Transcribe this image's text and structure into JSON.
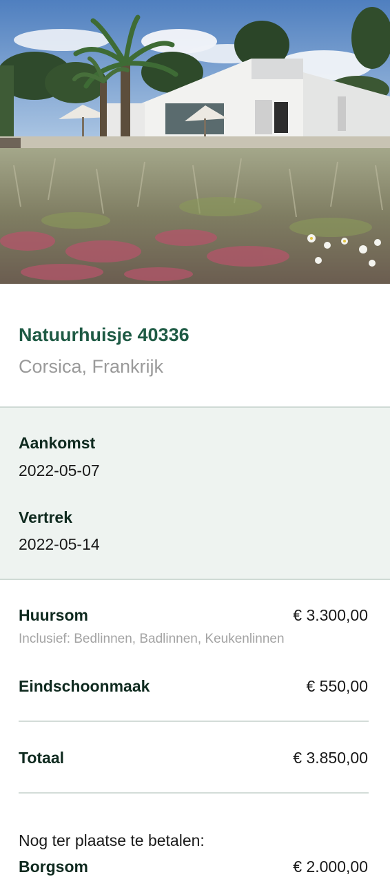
{
  "hero": {
    "photo_subject": "white-villa-with-palm-trees"
  },
  "house": {
    "name": "Natuurhuisje 40336",
    "location": "Corsica, Frankrijk"
  },
  "dates": {
    "arrival_label": "Aankomst",
    "arrival_value": "2022-05-07",
    "departure_label": "Vertrek",
    "departure_value": "2022-05-14"
  },
  "costs": {
    "rent_label": "Huursom",
    "rent_amount": "€ 3.300,00",
    "rent_note": "Inclusief: Bedlinnen, Badlinnen, Keukenlinnen",
    "cleaning_label": "Eindschoonmaak",
    "cleaning_amount": "€ 550,00",
    "total_label": "Totaal",
    "total_amount": "€ 3.850,00",
    "on_site_note": "Nog ter plaatse te betalen:",
    "deposit_label": "Borgsom",
    "deposit_amount": "€ 2.000,00"
  },
  "colors": {
    "accent_green": "#1e5a44",
    "panel_background": "#eef3f0",
    "muted_text": "#9a9a9a"
  }
}
